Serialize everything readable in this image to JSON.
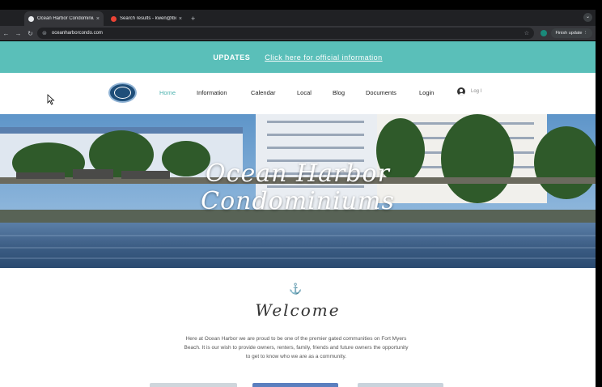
{
  "browser": {
    "tabs": [
      {
        "label": "Ocean Harbor Condominium",
        "active": true,
        "favicon_color": "#e8eaed"
      },
      {
        "label": "Search results - kwen@lbow",
        "active": false,
        "favicon_color": "#ea4335"
      }
    ],
    "new_tab": "+",
    "close_glyph": "×",
    "url": "oceanharborcondo.com",
    "finish_update": "Finish update ⋮",
    "menu_glyph": "⌄"
  },
  "site": {
    "updates": {
      "title": "UPDATES",
      "link": "Click here for official information"
    },
    "nav": {
      "items": [
        "Home",
        "Information",
        "Calendar",
        "Local",
        "Blog",
        "Documents",
        "Login"
      ],
      "active": "Home",
      "login_label": "Log I"
    },
    "hero": {
      "title_line1": "Ocean Harbor",
      "title_line2": "Condominiums"
    },
    "welcome": {
      "anchor_icon": "⚓",
      "title": "Welcome",
      "text": "Here at Ocean Harbor we are proud to be one of the premier gated communities on Fort Myers Beach. It is our wish to provide owners, renters, family, friends and future owners the opportunity to get to know who we are as a community."
    }
  },
  "colors": {
    "accent": "#5abfb9",
    "nav_active": "#4fb3b0"
  }
}
